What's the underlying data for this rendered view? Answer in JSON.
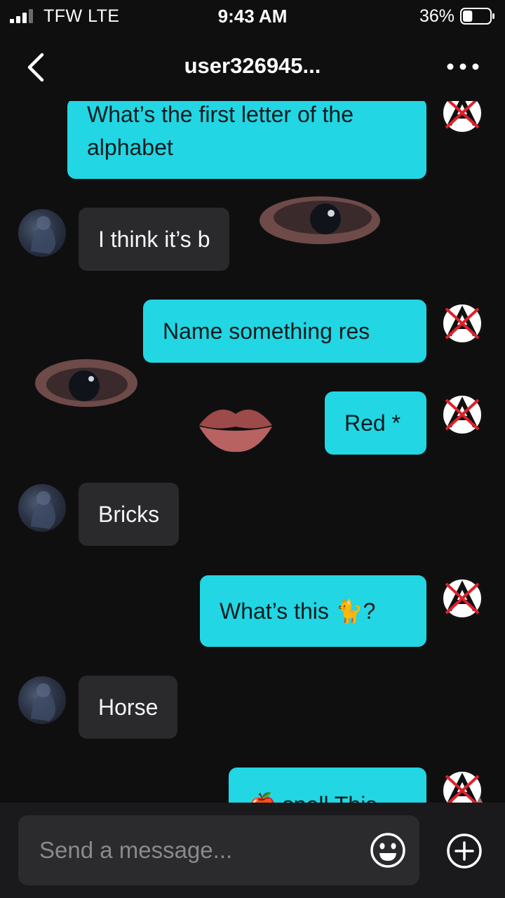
{
  "status_bar": {
    "carrier": "TFW  LTE",
    "time": "9:43 AM",
    "battery": "36%",
    "battery_level": 0.36
  },
  "header": {
    "title": "user326945..."
  },
  "messages": [
    {
      "side": "out",
      "text_line1": "What’s the first letter of the",
      "text_line2": "alphabet"
    },
    {
      "side": "in",
      "text": "I think it’s b"
    },
    {
      "side": "out",
      "text": "Name something res"
    },
    {
      "side": "out",
      "text": "Red *"
    },
    {
      "side": "in",
      "text": "Bricks"
    },
    {
      "side": "out",
      "text": "What’s this  🐈?"
    },
    {
      "side": "in",
      "text": "Horse"
    },
    {
      "side": "out",
      "text": "🍎 spell This"
    }
  ],
  "composer": {
    "placeholder": "Send a message..."
  },
  "colors": {
    "background": "#0f0f10",
    "outgoing_bubble": "#22d6e3",
    "incoming_bubble": "#2a2a2c",
    "accent_red": "#e0202a"
  },
  "icons": [
    "signal-icon",
    "battery-icon",
    "back-icon",
    "more-icon",
    "anarchy-avatar-icon",
    "emoji-icon",
    "plus-icon"
  ]
}
